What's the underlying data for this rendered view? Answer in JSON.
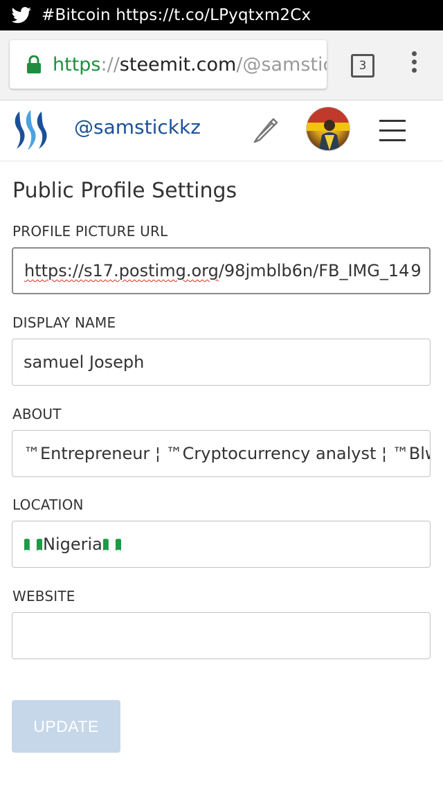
{
  "status_bar": {
    "notification_icon": "twitter-bird-icon",
    "notification_text": "#Bitcoin https://t.co/LPyqtxm2Cx"
  },
  "browser": {
    "url_scheme": "https",
    "url_separator": "://",
    "url_host": "steemit.com",
    "url_path": "/@samstic",
    "tab_count": "3"
  },
  "site_header": {
    "logo_icon": "steemit-logo-icon",
    "username": "@samstickkz"
  },
  "page": {
    "title": "Public Profile Settings"
  },
  "form": {
    "profile_picture_url": {
      "label": "PROFILE PICTURE URL",
      "value_part1": "https://s17.postimg.org",
      "value_part2": "/98jmblb6n/FB_IMG_14",
      "value_part3": "9"
    },
    "display_name": {
      "label": "DISPLAY NAME",
      "value": "samuel Joseph"
    },
    "about": {
      "label": "ABOUT",
      "value": "™Entrepreneur ¦ ™Cryptocurrency analyst ¦ ™Blw"
    },
    "location": {
      "label": "LOCATION",
      "value": "Nigeria "
    },
    "website": {
      "label": "WEBSITE",
      "value": ""
    },
    "update_label": "UPDATE"
  },
  "colors": {
    "brand_blue": "#1a5099",
    "secure_green": "#1e8e3e",
    "button_disabled": "#c7d7ea",
    "nigeria_green": "#1a9c46"
  }
}
